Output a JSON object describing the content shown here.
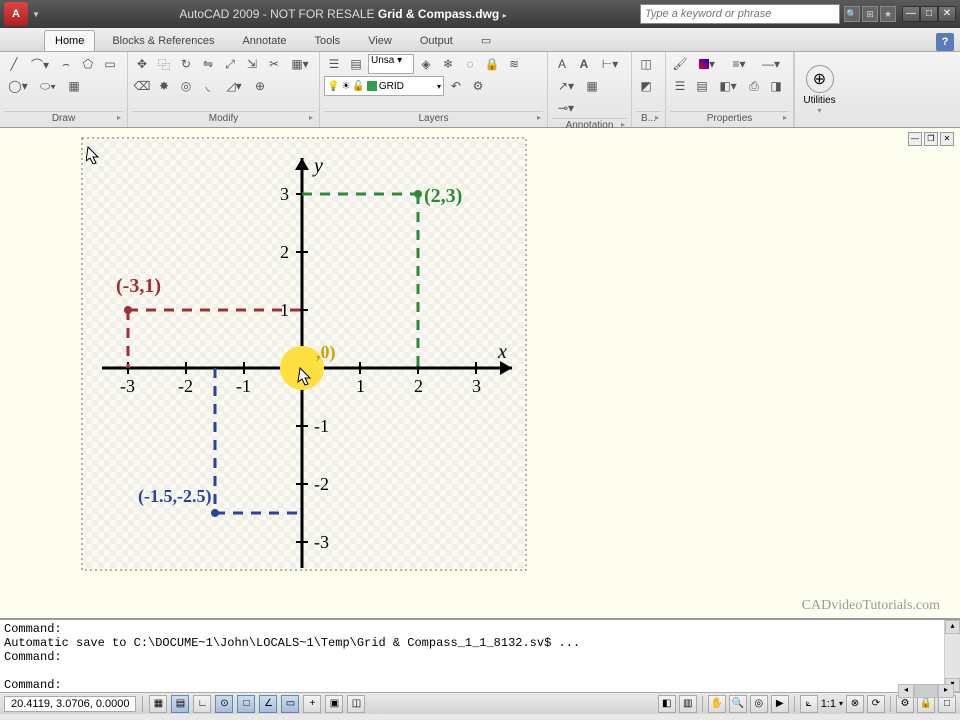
{
  "title": {
    "app": "AutoCAD 2009",
    "suffix": "- NOT FOR RESALE",
    "file": "Grid & Compass.dwg",
    "search_placeholder": "Type a keyword or phrase"
  },
  "ribbon": {
    "tabs": [
      "Home",
      "Blocks & References",
      "Annotate",
      "Tools",
      "View",
      "Output"
    ],
    "panels": {
      "draw": "Draw",
      "modify": "Modify",
      "layers": "Layers",
      "annotation": "Annotation",
      "block": "B...",
      "properties": "Properties",
      "utilities": "Utilities"
    },
    "layer_current": "GRID",
    "linetype_current": "Unsa"
  },
  "chart_data": {
    "type": "scatter",
    "title": "",
    "xlabel": "x",
    "ylabel": "y",
    "xlim": [
      -3,
      3
    ],
    "ylim": [
      -3,
      3
    ],
    "x_ticks": [
      -3,
      -2,
      -1,
      1,
      2,
      3
    ],
    "y_ticks": [
      -3,
      -2,
      -1,
      1,
      2,
      3
    ],
    "points": [
      {
        "label": "(-3,1)",
        "x": -3,
        "y": 1,
        "color": "#a03030"
      },
      {
        "label": "(2,3)",
        "x": 2,
        "y": 3,
        "color": "#2a8a3a"
      },
      {
        "label": "(-1.5,-2.5)",
        "x": -1.5,
        "y": -2.5,
        "color": "#3040a0"
      },
      {
        "label": "(0,0)",
        "x": 0,
        "y": 0,
        "color": "#e0a000",
        "highlight": true
      }
    ]
  },
  "command": {
    "lines": "Command:\nAutomatic save to C:\\DOCUME~1\\John\\LOCALS~1\\Temp\\Grid & Compass_1_1_8132.sv$ ...\nCommand:\n\nCommand:"
  },
  "status": {
    "coords": "20.4119, 3.0706, 0.0000",
    "scale": "1:1"
  },
  "watermark": "CADvideoTutorials.com"
}
